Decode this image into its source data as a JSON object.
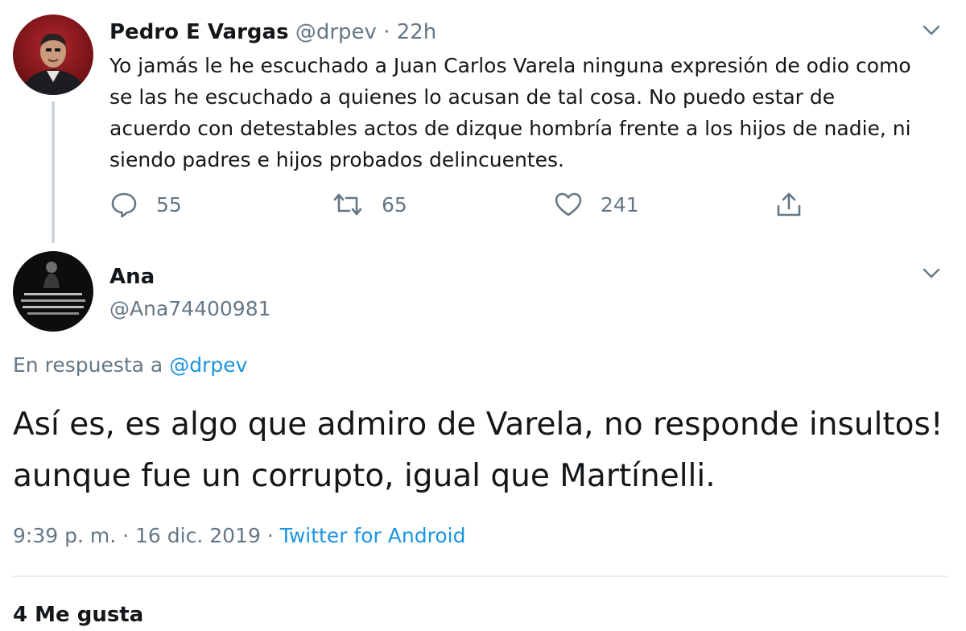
{
  "tweet1": {
    "author_name": "Pedro E Vargas",
    "handle": "@drpev",
    "separator": "·",
    "time": "22h",
    "text": "Yo jamás le he escuchado a Juan Carlos Varela ninguna expresión de odio como se las he escuchado a quienes lo acusan de tal cosa. No puedo estar de acuerdo con detestables actos de dizque hombría frente a los hijos de nadie, ni siendo padres e hijos probados delincuentes.",
    "replies": "55",
    "retweets": "65",
    "likes": "241",
    "icons": {
      "reply": "reply-icon",
      "retweet": "retweet-icon",
      "like": "heart-icon",
      "share": "share-icon",
      "menu": "chevron-down-icon"
    }
  },
  "tweet2": {
    "author_name": "Ana",
    "handle": "@Ana74400981",
    "reply_prefix": "En respuesta a",
    "reply_handle": "@drpev",
    "text": "Así es, es algo que admiro de Varela, no responde insultos! aunque fue un corrupto, igual que Martínelli.",
    "time": "9:39 p. m.",
    "date": "16 dic. 2019",
    "separator": "·",
    "source": "Twitter for Android",
    "stats_partial": "4 Me gusta"
  },
  "colors": {
    "text": "#14171a",
    "muted": "#657786",
    "link": "#1b95e0",
    "divider": "#e6ecf0",
    "thread_line": "#ccd6dd"
  }
}
